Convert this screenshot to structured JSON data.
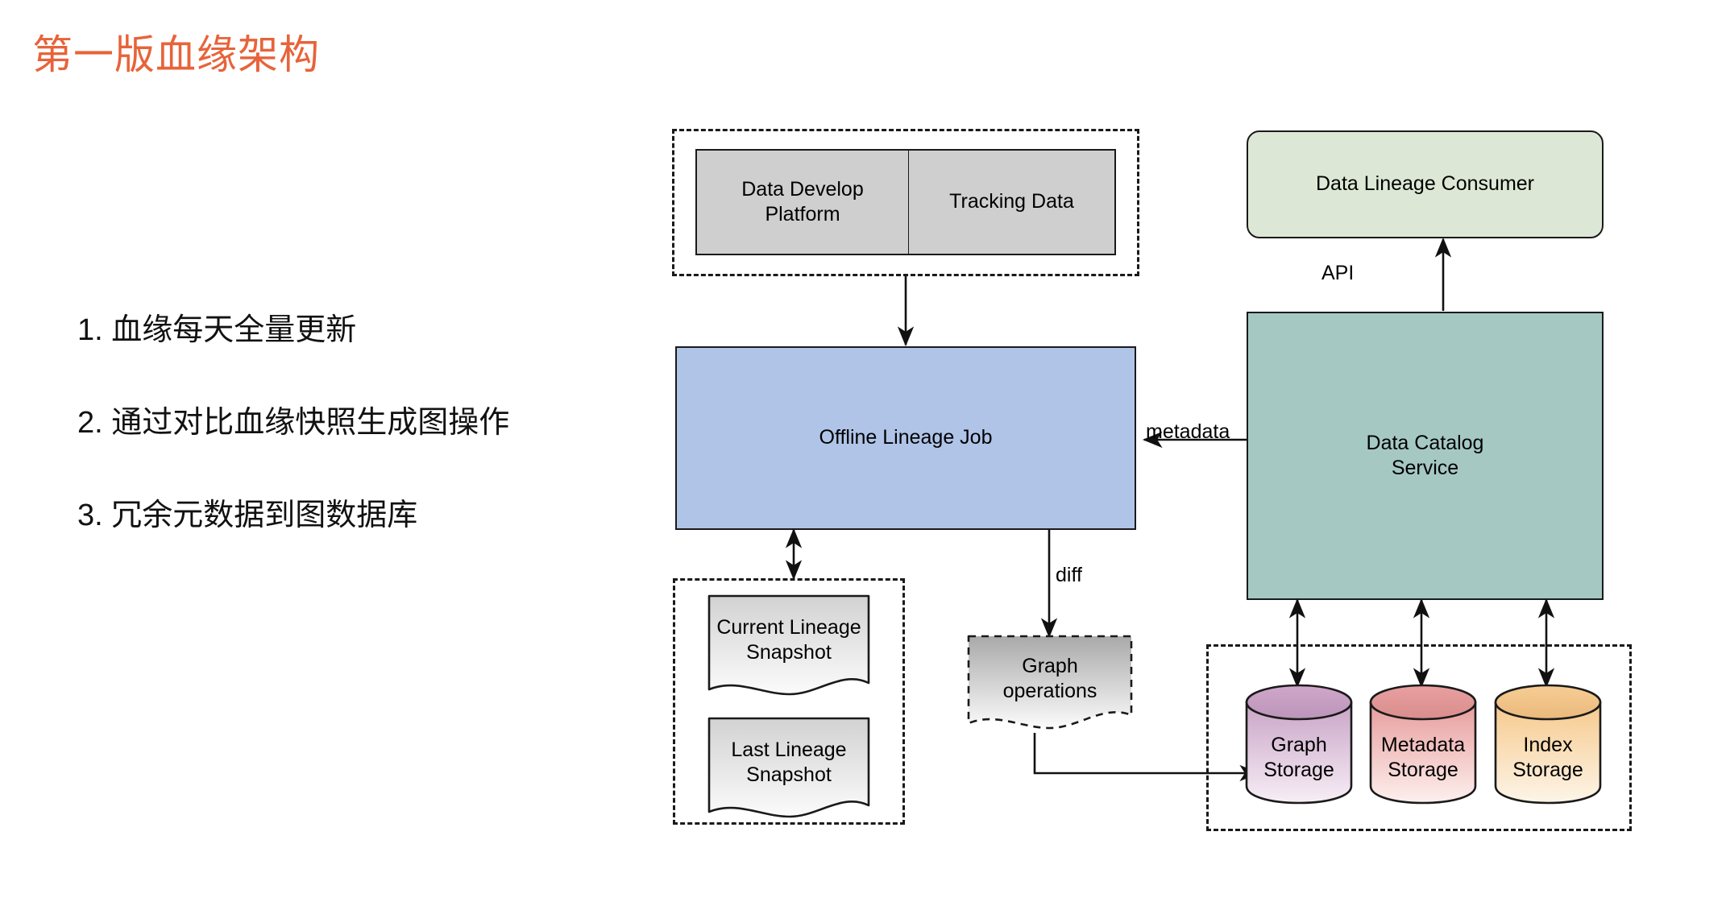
{
  "slide": {
    "title": "第一版血缘架构",
    "title_color": "#e8633a",
    "bullets": [
      "1. 血缘每天全量更新",
      "2. 通过对比血缘快照生成图操作",
      "3. 冗余元数据到图数据库"
    ]
  },
  "diagram": {
    "nodes": {
      "data_develop_platform": {
        "label": "Data Develop\nPlatform",
        "color": "#cfcfcf",
        "shape": "rect"
      },
      "tracking_data": {
        "label": "Tracking Data",
        "color": "#cfcfcf",
        "shape": "rect"
      },
      "offline_lineage_job": {
        "label": "Offline Lineage Job",
        "color": "#b0c4e8",
        "shape": "rect"
      },
      "data_lineage_consumer": {
        "label": "Data Lineage Consumer",
        "color": "#dce8d5",
        "shape": "rounded-rect"
      },
      "data_catalog_service": {
        "label": "Data Catalog\nService",
        "color": "#a5c8c3",
        "shape": "rect"
      },
      "current_lineage_snapshot": {
        "label": "Current Lineage\nSnapshot",
        "color": "#e3e3e3",
        "shape": "document"
      },
      "last_lineage_snapshot": {
        "label": "Last Lineage\nSnapshot",
        "color": "#e3e3e3",
        "shape": "document"
      },
      "graph_operations": {
        "label": "Graph\noperations",
        "color": "#e0e0e0",
        "shape": "document-dashed"
      },
      "graph_storage": {
        "label": "Graph\nStorage",
        "color": "#c9a8c4",
        "shape": "cylinder"
      },
      "metadata_storage": {
        "label": "Metadata\nStorage",
        "color": "#e8a0a0",
        "shape": "cylinder"
      },
      "index_storage": {
        "label": "Index\nStorage",
        "color": "#f5c98f",
        "shape": "cylinder"
      }
    },
    "edge_labels": {
      "api": "API",
      "metadata": "metadata",
      "diff": "diff"
    }
  }
}
